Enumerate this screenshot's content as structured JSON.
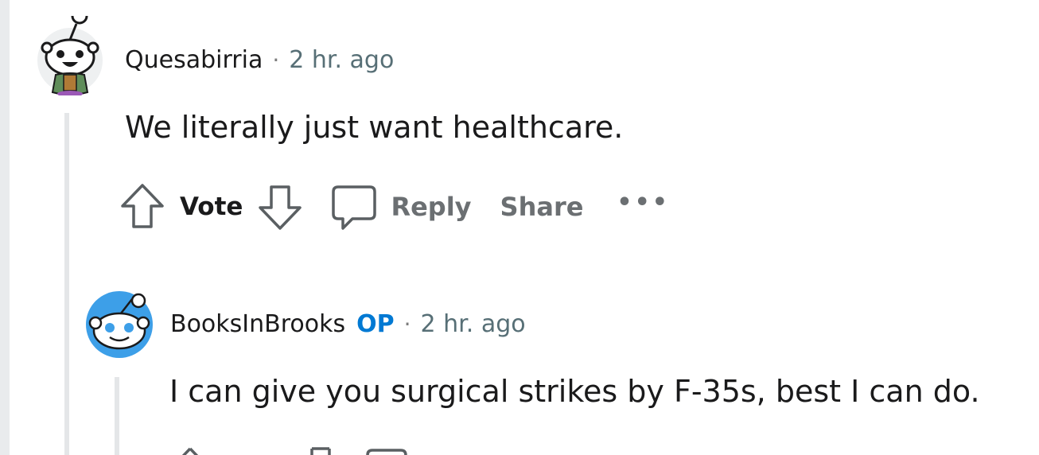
{
  "comments": [
    {
      "username": "Quesabirria",
      "op_badge": "",
      "separator": "·",
      "time": "2 hr. ago",
      "body": "We literally just want healthcare.",
      "avatar_icon": "snoo-avatar-icon",
      "actions": {
        "vote_label": "Vote",
        "reply_label": "Reply",
        "share_label": "Share",
        "more_label": "•••"
      }
    },
    {
      "username": "BooksInBrooks",
      "op_badge": "OP",
      "separator": "·",
      "time": "2 hr. ago",
      "body": "I can give you surgical strikes by F-35s, best I can do.",
      "avatar_icon": "snoo-avatar-icon"
    }
  ],
  "colors": {
    "op_badge": "#0079d3",
    "username": "#1a1a1b",
    "muted": "#576f76",
    "avatar_blue": "#3d9fe8"
  }
}
